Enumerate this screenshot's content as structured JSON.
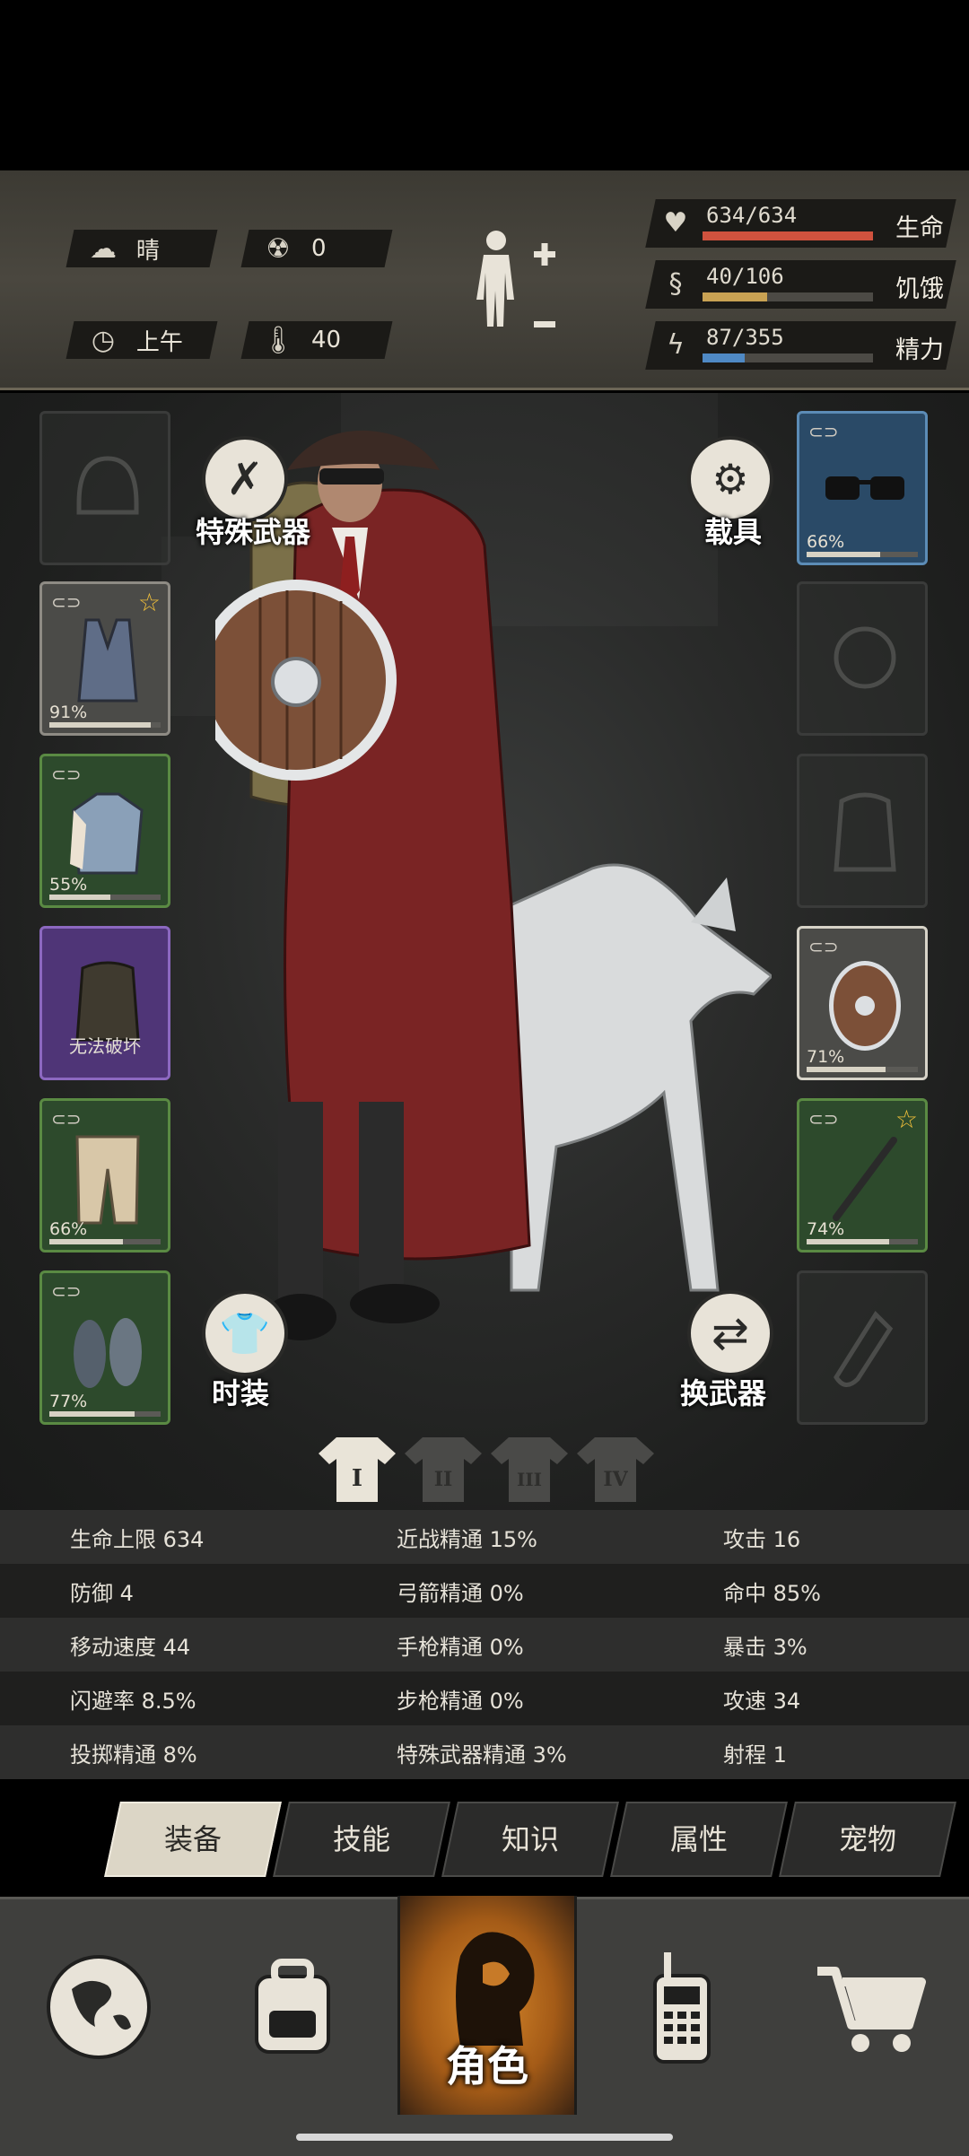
{
  "status": {
    "weather": {
      "icon": "cloud-sun-icon",
      "text": "晴"
    },
    "radiation": {
      "icon": "radiation-icon",
      "text": "0"
    },
    "time": {
      "icon": "clock-icon",
      "text": "上午"
    },
    "temperature": {
      "icon": "thermometer-icon",
      "text": "40"
    },
    "bars": [
      {
        "icon": "heart-icon",
        "value": "634/634",
        "label": "生命",
        "fill": 1.0,
        "color": "#d0523e"
      },
      {
        "icon": "stomach-icon",
        "value": "40/106",
        "label": "饥饿",
        "fill": 0.377,
        "color": "#c9a253"
      },
      {
        "icon": "energy-icon",
        "value": "87/355",
        "label": "精力",
        "fill": 0.245,
        "color": "#4f89c4"
      }
    ]
  },
  "equipment": {
    "left_slots": [
      {
        "name": "helmet-slot",
        "state": "empty"
      },
      {
        "name": "vest-slot",
        "rarity": "grey",
        "percent": "91%",
        "durability": 0.91,
        "starred": true
      },
      {
        "name": "jacket-slot",
        "rarity": "green",
        "percent": "55%",
        "durability": 0.55
      },
      {
        "name": "backpack-slot",
        "rarity": "purple",
        "caption": "无法破坏"
      },
      {
        "name": "pants-slot",
        "rarity": "green",
        "percent": "66%",
        "durability": 0.66
      },
      {
        "name": "shoes-slot",
        "rarity": "green",
        "percent": "77%",
        "durability": 0.77
      }
    ],
    "right_slots": [
      {
        "name": "glasses-slot",
        "rarity": "blue",
        "percent": "66%",
        "durability": 0.66
      },
      {
        "name": "mask-slot",
        "state": "empty"
      },
      {
        "name": "bag-slot",
        "state": "empty"
      },
      {
        "name": "shield-slot",
        "rarity": "grey",
        "percent": "71%",
        "durability": 0.71
      },
      {
        "name": "weapon-slot",
        "rarity": "green",
        "percent": "74%",
        "durability": 0.74,
        "starred": true
      },
      {
        "name": "throwable-slot",
        "state": "empty"
      }
    ],
    "buttons": {
      "special_weapon": "特殊武器",
      "vehicle": "载具",
      "fashion": "时装",
      "switch_weapon": "换武器"
    },
    "outfit_tabs": [
      "I",
      "II",
      "III",
      "IV"
    ]
  },
  "stats": [
    [
      "生命上限 634",
      "近战精通 15%",
      "攻击 16"
    ],
    [
      "防御 4",
      "弓箭精通 0%",
      "命中 85%"
    ],
    [
      "移动速度 44",
      "手枪精通 0%",
      "暴击 3%"
    ],
    [
      "闪避率 8.5%",
      "步枪精通 0%",
      "攻速 34"
    ],
    [
      "投掷精通 8%",
      "特殊武器精通 3%",
      "射程 1"
    ]
  ],
  "tabs": [
    "装备",
    "技能",
    "知识",
    "属性",
    "宠物"
  ],
  "active_tab": "装备",
  "nav": {
    "items": [
      "globe-icon",
      "backpack-icon",
      "character-icon",
      "radio-icon",
      "cart-icon"
    ],
    "active_label": "角色"
  }
}
